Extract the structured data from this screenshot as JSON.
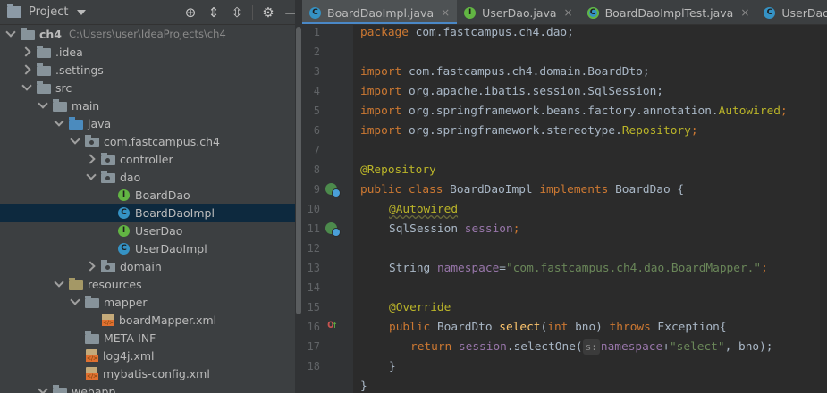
{
  "project_panel": {
    "title": "Project",
    "tools": [
      "locate-icon",
      "expand-all-icon",
      "collapse-all-icon",
      "gear-icon",
      "minimize-icon"
    ],
    "tree": [
      {
        "label": "ch4",
        "path": "C:\\Users\\user\\IdeaProjects\\ch4",
        "bold": true
      },
      {
        "label": ".idea"
      },
      {
        "label": ".settings"
      },
      {
        "label": "src"
      },
      {
        "label": "main"
      },
      {
        "label": "java"
      },
      {
        "label": "com.fastcampus.ch4"
      },
      {
        "label": "controller"
      },
      {
        "label": "dao"
      },
      {
        "label": "BoardDao",
        "badge": "I"
      },
      {
        "label": "BoardDaoImpl",
        "badge": "C"
      },
      {
        "label": "UserDao",
        "badge": "I"
      },
      {
        "label": "UserDaoImpl",
        "badge": "C"
      },
      {
        "label": "domain"
      },
      {
        "label": "resources"
      },
      {
        "label": "mapper"
      },
      {
        "label": "boardMapper.xml"
      },
      {
        "label": "META-INF"
      },
      {
        "label": "log4j.xml"
      },
      {
        "label": "mybatis-config.xml"
      },
      {
        "label": "webapp"
      }
    ]
  },
  "tabs": [
    {
      "label": "BoardDaoImpl.java",
      "badge": "C",
      "active": true
    },
    {
      "label": "UserDao.java",
      "badge": "I",
      "active": false
    },
    {
      "label": "BoardDaoImplTest.java",
      "badge": "C",
      "active": false
    },
    {
      "label": "UserDaoImpl.java",
      "badge": "C",
      "active": false
    }
  ],
  "code": {
    "line_numbers": [
      "1",
      "2",
      "3",
      "4",
      "5",
      "6",
      "7",
      "8",
      "9",
      "10",
      "11",
      "12",
      "13",
      "14",
      "15",
      "16",
      "17",
      "18"
    ],
    "l1_kw": "package",
    "l1_rest": " com.fastcampus.ch4.dao;",
    "l3_kw": "import",
    "l3_rest": " com.fastcampus.ch4.domain.BoardDto;",
    "l4_kw": "import",
    "l4_rest": " org.apache.ibatis.session.SqlSession;",
    "l5_kw": "import",
    "l5_pre": " org.springframework.beans.factory.annotation.",
    "l5_cls": "Autowired",
    "l5_semi": ";",
    "l6_kw": "import",
    "l6_pre": " org.springframework.stereotype.",
    "l6_cls": "Repository",
    "l6_semi": ";",
    "l8_ann": "@Repository",
    "l9_kw1": "public class",
    "l9_name": " BoardDaoImpl ",
    "l9_kw2": "implements",
    "l9_rest": " BoardDao {",
    "l10_ann": "@Autowired",
    "l11_type": "SqlSession ",
    "l11_fld": "session",
    "l11_semi": ";",
    "l13_type": "String ",
    "l13_fld": "namespace",
    "l13_eq": "=",
    "l13_str": "\"com.fastcampus.ch4.dao.BoardMapper.\"",
    "l13_semi": ";",
    "l15_ann": "@Override",
    "l16_kw1": "public",
    "l16_type": " BoardDto ",
    "l16_mth": "select",
    "l16_p1": "(",
    "l16_kw2": "int",
    "l16_p2": " bno) ",
    "l16_kw3": "throws",
    "l16_p3": " Exception{",
    "l17_kw": "return",
    "l17_fld": " session",
    "l17_call": ".selectOne(",
    "l17_hint": "s:",
    "l17_fld2": "namespace",
    "l17_plus": "+",
    "l17_str": "\"select\"",
    "l17_end": ", bno);",
    "l18": "}",
    "l19": "}"
  }
}
